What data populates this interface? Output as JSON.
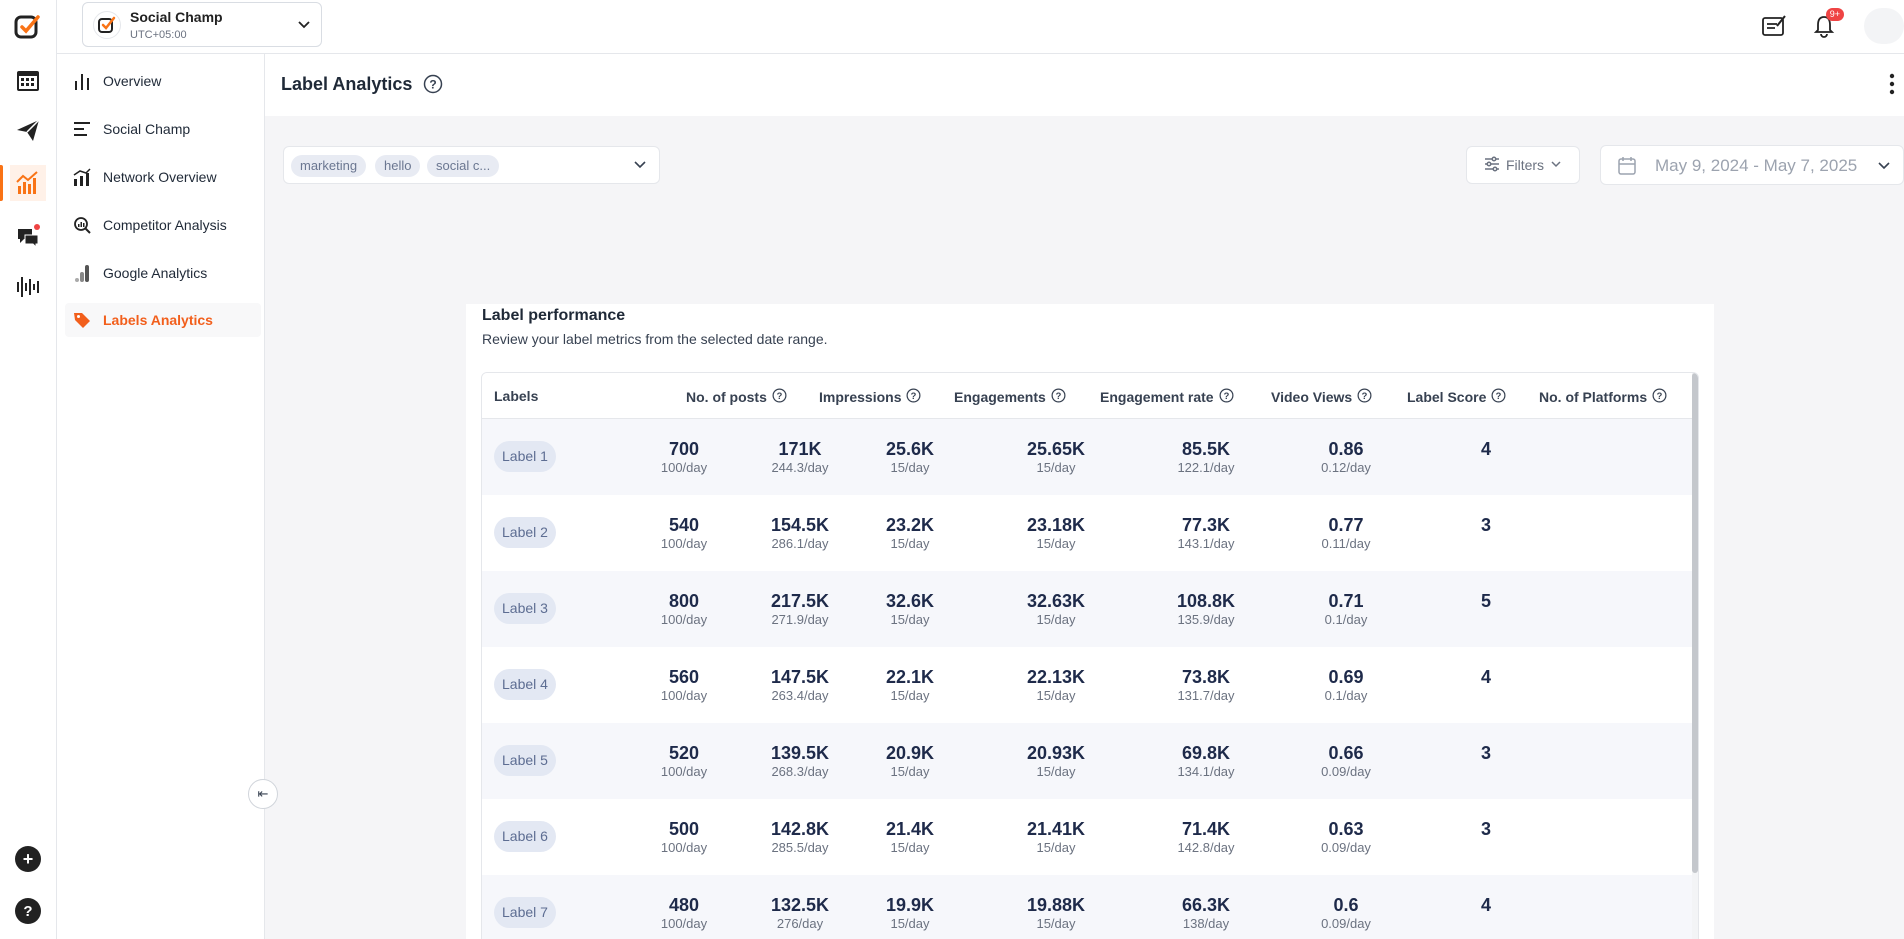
{
  "workspace": {
    "name": "Social Champ",
    "timezone": "UTC+05:00"
  },
  "topbar": {
    "notification_badge": "9+"
  },
  "sidebar": {
    "items": [
      {
        "label": "Overview",
        "icon": "bar-chart-icon"
      },
      {
        "label": "Social Champ",
        "icon": "align-left-icon"
      },
      {
        "label": "Network Overview",
        "icon": "network-chart-icon"
      },
      {
        "label": "Competitor Analysis",
        "icon": "competitor-icon"
      },
      {
        "label": "Google Analytics",
        "icon": "google-analytics-icon"
      },
      {
        "label": "Labels Analytics",
        "icon": "tag-icon"
      }
    ]
  },
  "page": {
    "title": "Label Analytics"
  },
  "filters": {
    "chips": [
      "marketing",
      "hello",
      "social c..."
    ],
    "filters_label": "Filters",
    "date_range": "May 9, 2024 - May 7, 2025"
  },
  "card": {
    "title": "Label performance",
    "subtitle": "Review your label metrics from the selected date range."
  },
  "table": {
    "columns": [
      "Labels",
      "No. of posts",
      "Impressions",
      "Engagements",
      "Engagement rate",
      "Video Views",
      "Label Score",
      "No. of Platforms"
    ],
    "rows": [
      {
        "label": "Label 1",
        "posts": "700",
        "posts_d": "100/day",
        "imp": "171K",
        "imp_d": "244.3/day",
        "eng": "25.6K",
        "eng_d": "15/day",
        "rate": "25.65K",
        "rate_d": "15/day",
        "vv": "85.5K",
        "vv_d": "122.1/day",
        "score": "0.86",
        "score_d": "0.12/day",
        "plat": "4"
      },
      {
        "label": "Label 2",
        "posts": "540",
        "posts_d": "100/day",
        "imp": "154.5K",
        "imp_d": "286.1/day",
        "eng": "23.2K",
        "eng_d": "15/day",
        "rate": "23.18K",
        "rate_d": "15/day",
        "vv": "77.3K",
        "vv_d": "143.1/day",
        "score": "0.77",
        "score_d": "0.11/day",
        "plat": "3"
      },
      {
        "label": "Label 3",
        "posts": "800",
        "posts_d": "100/day",
        "imp": "217.5K",
        "imp_d": "271.9/day",
        "eng": "32.6K",
        "eng_d": "15/day",
        "rate": "32.63K",
        "rate_d": "15/day",
        "vv": "108.8K",
        "vv_d": "135.9/day",
        "score": "0.71",
        "score_d": "0.1/day",
        "plat": "5"
      },
      {
        "label": "Label 4",
        "posts": "560",
        "posts_d": "100/day",
        "imp": "147.5K",
        "imp_d": "263.4/day",
        "eng": "22.1K",
        "eng_d": "15/day",
        "rate": "22.13K",
        "rate_d": "15/day",
        "vv": "73.8K",
        "vv_d": "131.7/day",
        "score": "0.69",
        "score_d": "0.1/day",
        "plat": "4"
      },
      {
        "label": "Label 5",
        "posts": "520",
        "posts_d": "100/day",
        "imp": "139.5K",
        "imp_d": "268.3/day",
        "eng": "20.9K",
        "eng_d": "15/day",
        "rate": "20.93K",
        "rate_d": "15/day",
        "vv": "69.8K",
        "vv_d": "134.1/day",
        "score": "0.66",
        "score_d": "0.09/day",
        "plat": "3"
      },
      {
        "label": "Label 6",
        "posts": "500",
        "posts_d": "100/day",
        "imp": "142.8K",
        "imp_d": "285.5/day",
        "eng": "21.4K",
        "eng_d": "15/day",
        "rate": "21.41K",
        "rate_d": "15/day",
        "vv": "71.4K",
        "vv_d": "142.8/day",
        "score": "0.63",
        "score_d": "0.09/day",
        "plat": "3"
      },
      {
        "label": "Label 7",
        "posts": "480",
        "posts_d": "100/day",
        "imp": "132.5K",
        "imp_d": "276/day",
        "eng": "19.9K",
        "eng_d": "15/day",
        "rate": "19.88K",
        "rate_d": "15/day",
        "vv": "66.3K",
        "vv_d": "138/day",
        "score": "0.6",
        "score_d": "0.09/day",
        "plat": "4"
      }
    ]
  },
  "colors": {
    "accent": "#f25f1c",
    "chip_bg": "#e3e8f3",
    "row_alt": "#f6f7fb"
  }
}
